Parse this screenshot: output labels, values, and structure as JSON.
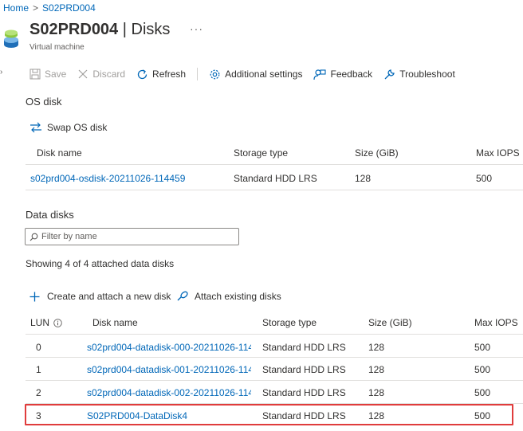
{
  "breadcrumb": {
    "home": "Home",
    "separator": ">",
    "current": "S02PRD004"
  },
  "header": {
    "resource": "S02PRD004",
    "divider": " | ",
    "page": "Disks",
    "more": "···",
    "subtitle": "Virtual machine"
  },
  "toolbar": {
    "save": "Save",
    "discard": "Discard",
    "refresh": "Refresh",
    "additional_settings": "Additional settings",
    "feedback": "Feedback",
    "troubleshoot": "Troubleshoot"
  },
  "os_disk": {
    "title": "OS disk",
    "swap_label": "Swap OS disk",
    "columns": [
      "Disk name",
      "Storage type",
      "Size (GiB)",
      "Max IOPS"
    ],
    "row": {
      "name": "s02prd004-osdisk-20211026-114459",
      "storage": "Standard HDD LRS",
      "size": "128",
      "iops": "500"
    }
  },
  "data_disks": {
    "title": "Data disks",
    "filter_placeholder": "Filter by name",
    "showing_text": "Showing 4 of 4 attached data disks",
    "create_label": "Create and attach a new disk",
    "attach_label": "Attach existing disks",
    "columns": {
      "lun": "LUN",
      "name": "Disk name",
      "storage": "Storage type",
      "size": "Size (GiB)",
      "iops": "Max IOPS"
    },
    "rows": [
      {
        "lun": "0",
        "name": "s02prd004-datadisk-000-20211026-114",
        "storage": "Standard HDD LRS",
        "size": "128",
        "iops": "500"
      },
      {
        "lun": "1",
        "name": "s02prd004-datadisk-001-20211026-114",
        "storage": "Standard HDD LRS",
        "size": "128",
        "iops": "500"
      },
      {
        "lun": "2",
        "name": "s02prd004-datadisk-002-20211026-114",
        "storage": "Standard HDD LRS",
        "size": "128",
        "iops": "500"
      },
      {
        "lun": "3",
        "name": "S02PRD004-DataDisk4",
        "storage": "Standard HDD LRS",
        "size": "128",
        "iops": "500"
      }
    ]
  },
  "colors": {
    "link": "#0067b8",
    "highlight": "#e03c3c",
    "text": "#323130",
    "muted": "#a19f9d"
  },
  "icons": [
    "vm-icon",
    "save-icon",
    "discard-icon",
    "refresh-icon",
    "gear-icon",
    "feedback-icon",
    "wrench-icon",
    "swap-icon",
    "search-icon",
    "plus-icon",
    "attach-icon",
    "info-icon"
  ]
}
